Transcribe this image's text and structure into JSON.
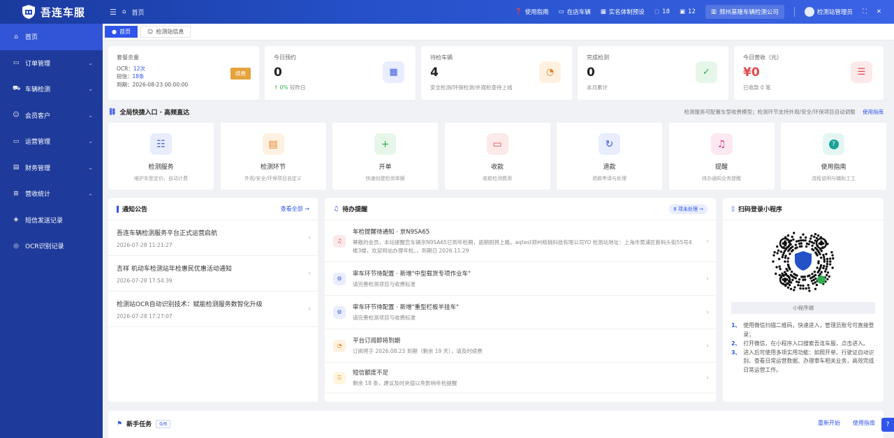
{
  "app": {
    "title": "吾连车服"
  },
  "header": {
    "breadcrumb": "首页",
    "guide": "使用指南",
    "vehicles_in_shop": "在店车辆",
    "verify_status": "实名体制预设",
    "msg_count": "18",
    "notice_count": "12",
    "company": "郑州基隆车辆检测公司",
    "user": "检测站管理员"
  },
  "sidebar": {
    "items": [
      {
        "label": "首页",
        "icon": "home-icon"
      },
      {
        "label": "订单管理",
        "icon": "monitor-icon"
      },
      {
        "label": "车辆检测",
        "icon": "car-icon"
      },
      {
        "label": "会员客户",
        "icon": "user-icon"
      },
      {
        "label": "运营管理",
        "icon": "monitor-icon"
      },
      {
        "label": "财务管理",
        "icon": "wallet-icon"
      },
      {
        "label": "营收统计",
        "icon": "grid-icon"
      },
      {
        "label": "短信发送记录",
        "icon": "box-icon"
      },
      {
        "label": "OCR识别记录",
        "icon": "target-icon"
      }
    ]
  },
  "tabs": [
    {
      "label": "首页"
    },
    {
      "label": "检测站信息"
    }
  ],
  "stats": {
    "package": {
      "title": "套餐余量",
      "ocr_label": "OCR：",
      "ocr_value": "12次",
      "sms_label": "短信：",
      "sms_value": "18条",
      "expire_label": "到期：",
      "expire_value": "2026-08-23 00:00:00",
      "renew": "续费"
    },
    "today_booking": {
      "title": "今日预约",
      "value": "0",
      "delta": "↑ 0%",
      "delta_label": "较昨日"
    },
    "pending": {
      "title": "待检车辆",
      "value": "4",
      "desc": "安全检测/环保检测/外观检查待上线"
    },
    "done": {
      "title": "完成检测",
      "value": "0",
      "desc": "本月累计"
    },
    "revenue": {
      "title": "今日营收（元）",
      "value": "¥0",
      "desc": "已收款 0 笔"
    }
  },
  "quick": {
    "title": "全局快捷入口 · 高频直达",
    "note": "检测服务可配置车型收费模型；检测环节支持外观/安全/环保项目自动调整",
    "guide_link": "使用指南",
    "items": [
      {
        "title": "检测服务",
        "desc": "维护车型定价、自动计费",
        "icon": "sliders-icon",
        "color": "#3b5bdb",
        "bg": "#e8edff"
      },
      {
        "title": "检测环节",
        "desc": "外观/安全/环保项目自定义",
        "icon": "clipboard-icon",
        "color": "#e67e22",
        "bg": "#fff1e0"
      },
      {
        "title": "开单",
        "desc": "快速创建检测单据",
        "icon": "plus-icon",
        "color": "#2eaf4f",
        "bg": "#e6f7ea"
      },
      {
        "title": "收款",
        "desc": "收款检测费用",
        "icon": "card-icon",
        "color": "#e0474c",
        "bg": "#fde9ea"
      },
      {
        "title": "退款",
        "desc": "退款申请与处理",
        "icon": "refresh-icon",
        "color": "#3b5bdb",
        "bg": "#e8edff"
      },
      {
        "title": "提醒",
        "desc": "待办通知业务提醒",
        "icon": "bell-icon",
        "color": "#d63384",
        "bg": "#fde8f2"
      },
      {
        "title": "使用指南",
        "desc": "流程说明与辅助工工",
        "icon": "help-icon",
        "color": "#ffffff",
        "bg": "#e3f6f3"
      }
    ]
  },
  "notices": {
    "title": "通知公告",
    "view_all": "查看全部 →",
    "items": [
      {
        "title": "吾连车辆检测服务平台正式运营启航",
        "date": "2026-07-28 11:21:27"
      },
      {
        "title": "吉祥 机动车检测站年检惠民优惠活动通知",
        "date": "2026-07-28 17:54:39"
      },
      {
        "title": "检测站OCR自动识别技术：赋能检测服务数智化升级",
        "date": "2026-07-28 17:27:07"
      }
    ]
  },
  "todos": {
    "title": "待办提醒",
    "badge": "8 项未处理 →",
    "items": [
      {
        "title": "年检提醒待通知 · 京N9SA65",
        "desc": "尊敬的会员，本站提醒您车辆京N9SA65已到年检期，逾期则将上路。aqtest郑州核桃科技有限公司YO 检测站地址：上海市黄浦区新码头街55号4楼3楼，欢迎到站办理年检。，到期日 2026.11.29",
        "icon": "bell-icon",
        "color": "#e0474c",
        "bg": "#fde9ea",
        "h": 60
      },
      {
        "title": "审车环节待配置 · 新增\"中型载货专项作业车\"",
        "desc": "请完善检测项目与收费标准",
        "icon": "gear-icon",
        "color": "#3b5bdb",
        "bg": "#e8edff",
        "h": 48
      },
      {
        "title": "审车环节待配置 · 新增\"重型栏板半挂车\"",
        "desc": "请完善检测项目与收费标准",
        "icon": "gear-icon",
        "color": "#3b5bdb",
        "bg": "#e8edff",
        "h": 48
      },
      {
        "title": "平台订阅即将到期",
        "desc": "订阅将于 2026.08.23 到期（剩余 19 天），请及时续费",
        "icon": "clock-icon",
        "color": "#e67e22",
        "bg": "#fff1e0",
        "h": 48
      },
      {
        "title": "短信额度不足",
        "desc": "剩余 18 条，建议及时充值以免影响年检提醒",
        "icon": "coins-icon",
        "color": "#e6a23c",
        "bg": "#fff6e0",
        "h": 44
      }
    ]
  },
  "miniprogram": {
    "title": "扫码登录小程序",
    "caption": "小程序端",
    "steps": [
      "使用微信扫描二维码，快速进入，管理员账号可直接登录；",
      "打开微信，在小程序入口搜索吾连车服，点击进入。",
      "进入后可使用多项实用功能：如照开单、行驶证自动识别、查看日常运营数据、办理审车相关业务，高效完成日常运营工作。"
    ]
  },
  "newbie": {
    "title": "新手任务",
    "progress": "0/6",
    "restart": "重新开始",
    "guide": "使用指南"
  },
  "colors": {
    "primary": "#2f54eb",
    "sidebar": "#1e3a9b",
    "danger": "#e0474c",
    "warning": "#e6a23c"
  }
}
